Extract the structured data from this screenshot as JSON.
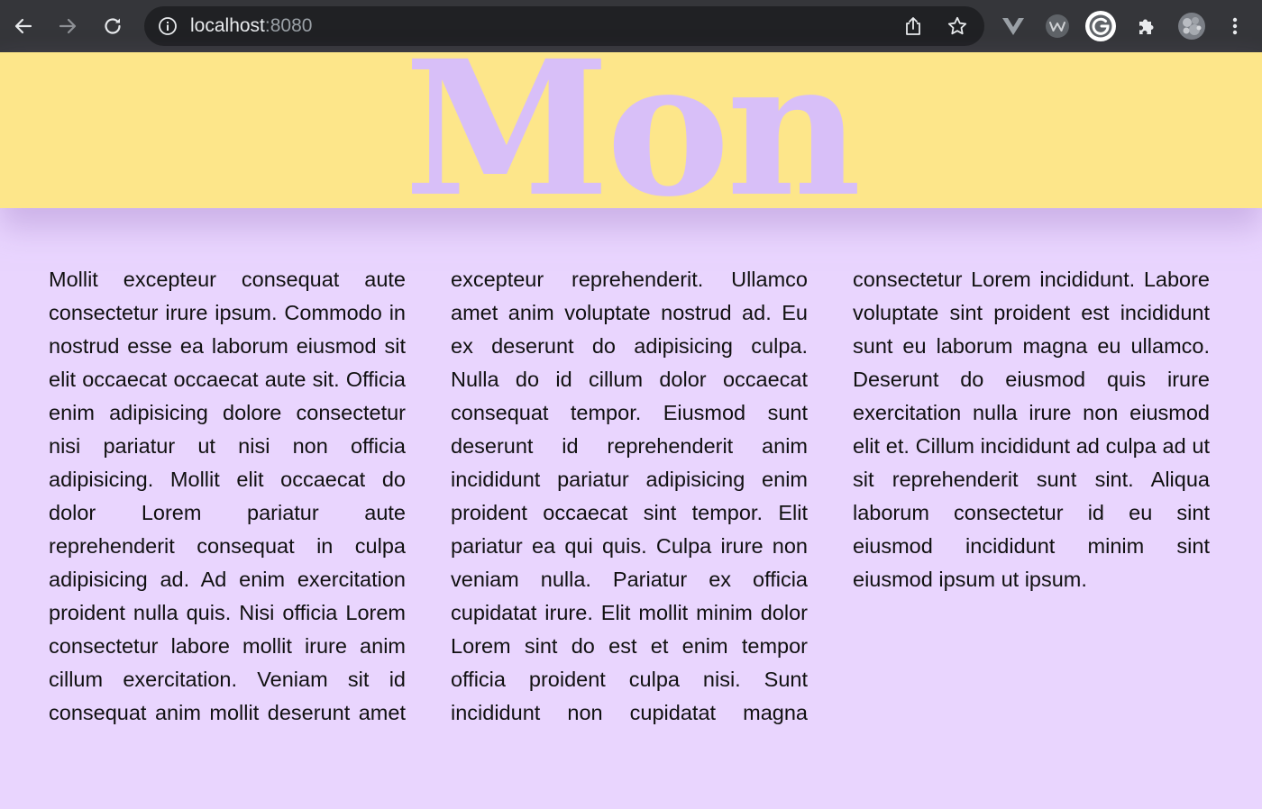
{
  "browser": {
    "url_host": "localhost",
    "url_port": ":8080",
    "colors": {
      "frame": "#35363a",
      "omnibox": "#202124"
    },
    "nav": {
      "back_icon": "arrow-left-icon",
      "forward_icon": "arrow-right-icon",
      "reload_icon": "reload-icon"
    },
    "omnibox_icons": [
      "info-icon",
      "share-icon",
      "bookmark-star-icon"
    ],
    "extensions": [
      "vue-devtools-icon",
      "w-extension-icon",
      "grammarly-icon",
      "extensions-puzzle-icon",
      "profile-avatar",
      "more-menu-icon"
    ]
  },
  "page": {
    "header": {
      "title": "Mon",
      "background": "#fde68a",
      "title_color": "#d8bff8"
    },
    "background": "#e9d5fe",
    "body_text": "Mollit excepteur consequat aute consectetur irure ipsum. Commodo in nostrud esse ea laborum eiusmod sit elit occaecat occaecat aute sit. Officia enim adipisicing dolore consectetur nisi pariatur ut nisi non officia adipisicing. Mollit elit occaecat do dolor Lorem pariatur aute reprehenderit consequat in culpa adipisicing ad. Ad enim exercitation proident nulla quis. Nisi officia Lorem consectetur labore mollit irure anim cillum exercitation. Veniam sit id consequat anim mollit deserunt amet excepteur reprehenderit. Ullamco amet anim voluptate nostrud ad. Eu ex deserunt do adipisicing culpa. Nulla do id cillum dolor occaecat consequat tempor. Eiusmod sunt deserunt id reprehenderit anim incididunt pariatur adipisicing enim proident occaecat sint tempor. Elit pariatur ea qui quis. Culpa irure non veniam nulla. Pariatur ex officia cupidatat irure. Elit mollit minim dolor Lorem sint do est et enim tempor officia proident culpa nisi. Sunt incididunt non cupidatat magna consectetur Lorem incididunt. Labore voluptate sint proident est incididunt sunt eu laborum magna eu ullamco. Deserunt do eiusmod quis irure exercitation nulla irure non eiusmod elit et. Cillum incididunt ad culpa ad ut sit reprehenderit sunt sint. Aliqua laborum consectetur id eu sint eiusmod incididunt minim sint eiusmod ipsum ut ipsum."
  }
}
